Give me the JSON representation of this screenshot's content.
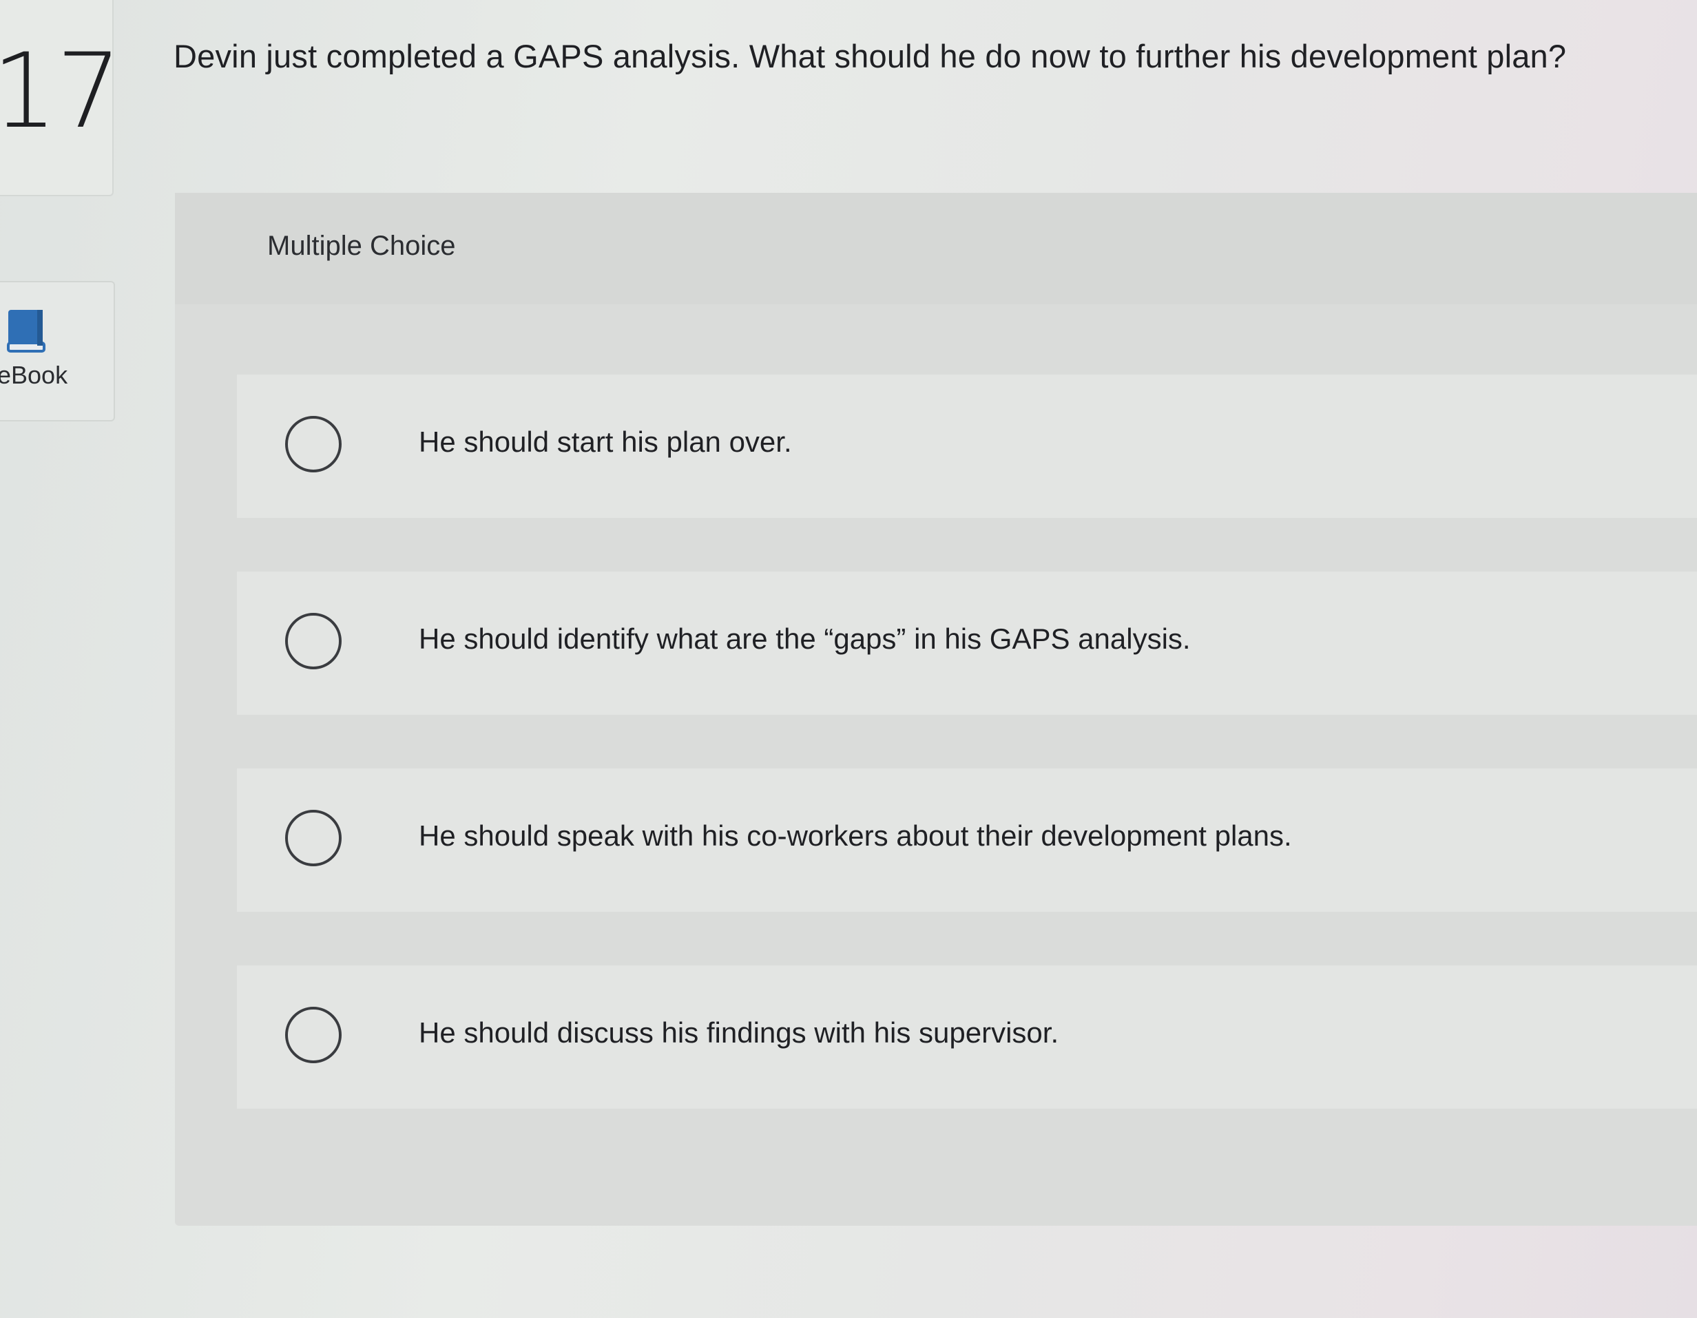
{
  "sidebar": {
    "question_number": "17",
    "ebook_label": "eBook"
  },
  "question": {
    "text": "Devin just completed a GAPS analysis. What should he do now to further his development plan?"
  },
  "choices": {
    "title": "Multiple Choice",
    "options": [
      {
        "label": "He should start his plan over.",
        "selected": false
      },
      {
        "label": "He should identify what are the “gaps” in his GAPS analysis.",
        "selected": false
      },
      {
        "label": "He should speak with his co-workers about their development plans.",
        "selected": false
      },
      {
        "label": "He should discuss his findings with his supervisor.",
        "selected": false
      }
    ]
  },
  "colors": {
    "ebook_icon": "#2f6fb5",
    "text": "#1f2024"
  }
}
